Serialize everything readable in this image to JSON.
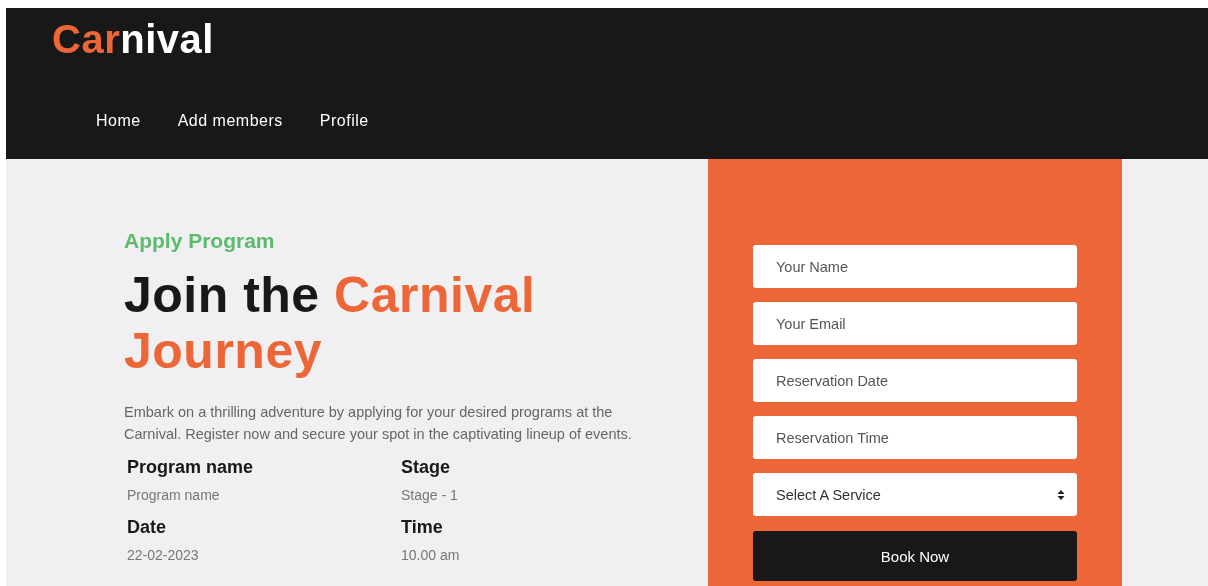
{
  "logo": {
    "accent": "Car",
    "rest": "nival"
  },
  "nav": [
    {
      "label": "Home"
    },
    {
      "label": "Add members"
    },
    {
      "label": "Profile"
    }
  ],
  "intro": {
    "eyebrow": "Apply Program",
    "heading_plain": "Join the ",
    "heading_accent": "Carnival Journey",
    "description": "Embark on a thrilling adventure by applying for your desired programs at the Carnival. Register now and secure your spot in the captivating lineup of events."
  },
  "details": [
    {
      "label": "Program name",
      "value": "Program name"
    },
    {
      "label": "Stage",
      "value": "Stage - 1"
    },
    {
      "label": "Date",
      "value": "22-02-2023"
    },
    {
      "label": "Time",
      "value": "10.00 am"
    }
  ],
  "form": {
    "fields": [
      {
        "kind": "text",
        "placeholder": "Your Name"
      },
      {
        "kind": "text",
        "placeholder": "Your Email"
      },
      {
        "kind": "text",
        "placeholder": "Reservation Date"
      },
      {
        "kind": "text",
        "placeholder": "Reservation Time"
      },
      {
        "kind": "select",
        "value": "Select A Service"
      }
    ],
    "button": "Book Now"
  }
}
